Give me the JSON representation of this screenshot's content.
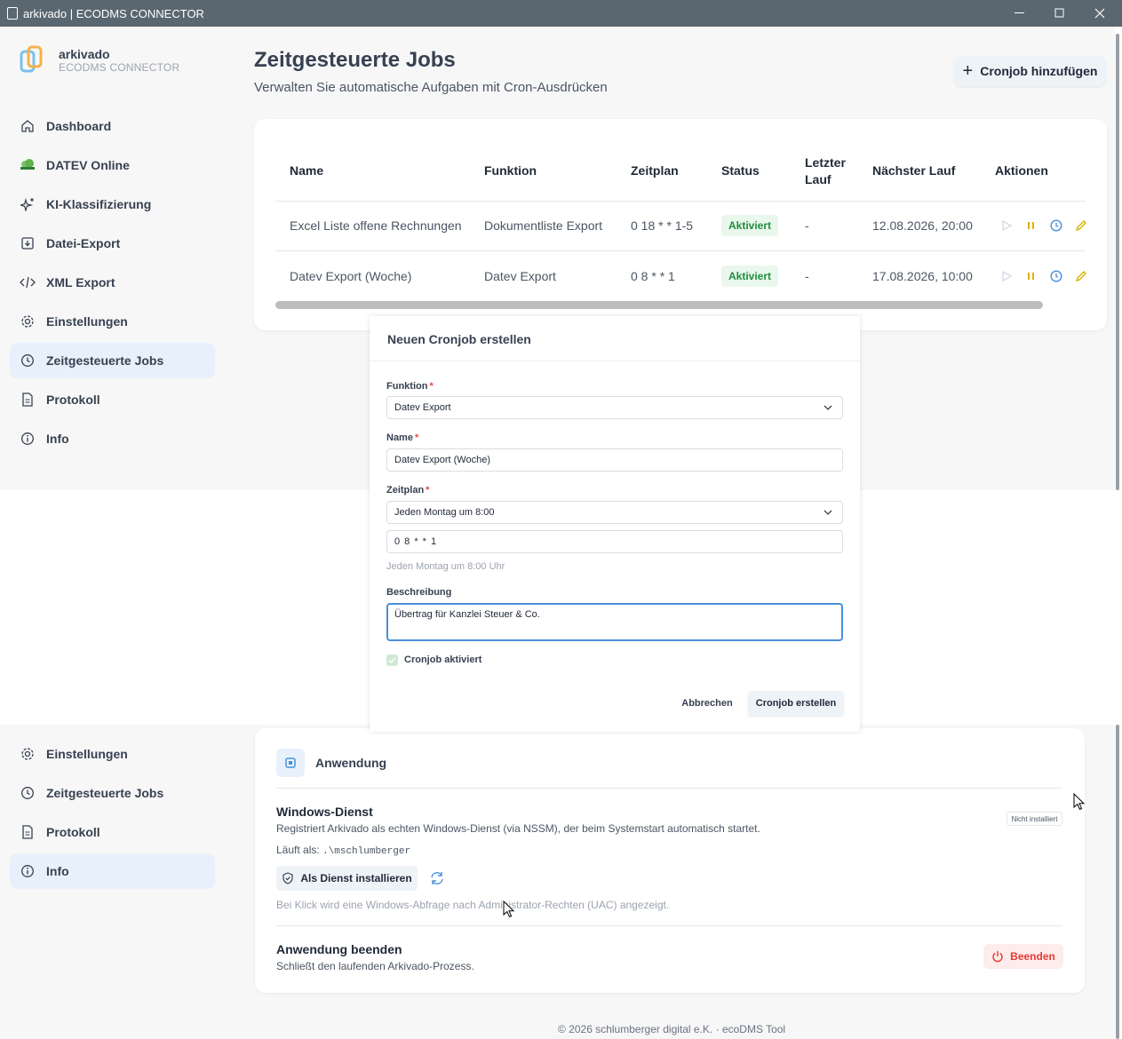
{
  "window": {
    "title": "arkivado | ECODMS CONNECTOR"
  },
  "brand": {
    "name": "arkivado",
    "subtitle": "ECODMS CONNECTOR"
  },
  "sidebar": {
    "items": [
      {
        "label": "Dashboard",
        "icon": "home-icon"
      },
      {
        "label": "DATEV Online",
        "icon": "datev-icon"
      },
      {
        "label": "KI-Klassifizierung",
        "icon": "sparkles-icon"
      },
      {
        "label": "Datei-Export",
        "icon": "file-export-icon"
      },
      {
        "label": "XML Export",
        "icon": "code-icon"
      },
      {
        "label": "Einstellungen",
        "icon": "gear-icon"
      },
      {
        "label": "Zeitgesteuerte Jobs",
        "icon": "clock-icon",
        "active": true
      },
      {
        "label": "Protokoll",
        "icon": "document-icon"
      },
      {
        "label": "Info",
        "icon": "info-icon"
      }
    ],
    "lower_items": [
      {
        "label": "Einstellungen",
        "icon": "gear-icon"
      },
      {
        "label": "Zeitgesteuerte Jobs",
        "icon": "clock-icon"
      },
      {
        "label": "Protokoll",
        "icon": "document-icon"
      },
      {
        "label": "Info",
        "icon": "info-icon",
        "active": true
      }
    ]
  },
  "header": {
    "title": "Zeitgesteuerte Jobs",
    "subtitle": "Verwalten Sie automatische Aufgaben mit Cron-Ausdrücken",
    "add_button": "Cronjob hinzufügen"
  },
  "table": {
    "columns": [
      "Name",
      "Funktion",
      "Zeitplan",
      "Status",
      "Letzter Lauf",
      "Nächster Lauf",
      "Aktionen"
    ],
    "col_letzter_1": "Letzter",
    "col_letzter_2": "Lauf",
    "rows": [
      {
        "name": "Excel Liste offene Rechnungen",
        "funktion": "Dokumentliste Export",
        "zeitplan": "0 18 * * 1-5",
        "status": "Aktiviert",
        "letzter": "-",
        "naechster": "12.08.2026, 20:00"
      },
      {
        "name": "Datev Export (Woche)",
        "funktion": "Datev Export",
        "zeitplan": "0 8 * * 1",
        "status": "Aktiviert",
        "letzter": "-",
        "naechster": "17.08.2026, 10:00"
      }
    ]
  },
  "modal": {
    "title": "Neuen Cronjob erstellen",
    "funktion_label": "Funktion",
    "funktion_value": "Datev Export",
    "name_label": "Name",
    "name_value": "Datev Export (Woche)",
    "zeitplan_label": "Zeitplan",
    "zeitplan_value": "Jeden Montag um 8:00",
    "cron_value": "0 8 * * 1",
    "cron_hint": "Jeden Montag um 8:00 Uhr",
    "beschreibung_label": "Beschreibung",
    "beschreibung_value": "Übertrag für Kanzlei Steuer & Co.",
    "aktiv_label": "Cronjob aktiviert",
    "aktiv_checked": true,
    "cancel": "Abbrechen",
    "create": "Cronjob erstellen",
    "required_mark": "*"
  },
  "app_section": {
    "title": "Anwendung",
    "service_title": "Windows-Dienst",
    "service_desc": "Registriert Arkivado als echten Windows-Dienst (via NSSM), der beim Systemstart automatisch startet.",
    "runs_as_label": "Läuft als:",
    "runs_as_value": ".\\mschlumberger",
    "status_badge": "Nicht installiert",
    "install_button": "Als Dienst installieren",
    "uac_note": "Bei Klick wird eine Windows-Abfrage nach Administrator-Rechten (UAC) angezeigt.",
    "quit_title": "Anwendung beenden",
    "quit_desc": "Schließt den laufenden Arkivado-Prozess.",
    "quit_button": "Beenden"
  },
  "footer": {
    "text": "© 2026 schlumberger digital e.K. · ecoDMS Tool"
  },
  "colors": {
    "accent": "#4a90d9",
    "active_bg": "#e8f1fb",
    "status_green": "#1e8e3e",
    "danger": "#e53935",
    "pause": "#e0b000",
    "edit": "#d9b400"
  }
}
